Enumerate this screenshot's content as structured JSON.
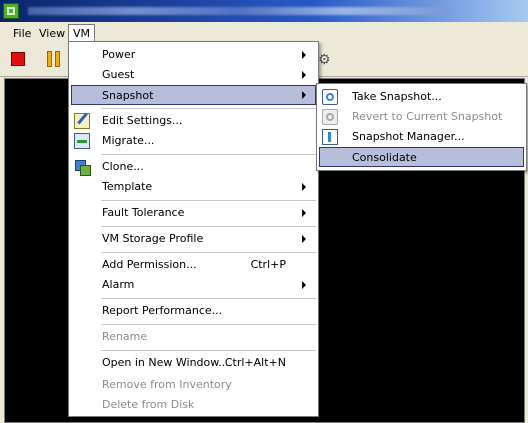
{
  "menubar": {
    "items": [
      {
        "label": "File"
      },
      {
        "label": "View"
      },
      {
        "label": "VM"
      }
    ]
  },
  "vm_menu": {
    "items": [
      {
        "label": "Power",
        "submenu": true
      },
      {
        "label": "Guest",
        "submenu": true
      },
      {
        "label": "Snapshot",
        "submenu": true,
        "highlighted": true
      },
      {
        "label": "Edit Settings...",
        "icon": "edit-settings-icon"
      },
      {
        "label": "Migrate...",
        "icon": "migrate-icon"
      },
      {
        "label": "Clone...",
        "icon": "clone-icon"
      },
      {
        "label": "Template",
        "submenu": true
      },
      {
        "label": "Fault Tolerance",
        "submenu": true
      },
      {
        "label": "VM Storage Profile",
        "submenu": true
      },
      {
        "label": "Add Permission...",
        "shortcut": "Ctrl+P"
      },
      {
        "label": "Alarm",
        "submenu": true
      },
      {
        "label": "Report Performance..."
      },
      {
        "label": "Rename",
        "disabled": true
      },
      {
        "label": "Open in New Window...",
        "shortcut": "Ctrl+Alt+N"
      },
      {
        "label": "Remove from Inventory",
        "disabled": true
      },
      {
        "label": "Delete from Disk",
        "disabled": true
      }
    ]
  },
  "snapshot_menu": {
    "items": [
      {
        "label": "Take Snapshot...",
        "icon": "take-snapshot-icon"
      },
      {
        "label": "Revert to Current Snapshot",
        "icon": "revert-snapshot-icon",
        "disabled": true
      },
      {
        "label": "Snapshot Manager...",
        "icon": "snapshot-manager-icon"
      },
      {
        "label": "Consolidate",
        "highlighted": true
      }
    ]
  },
  "colors": {
    "menu_highlight": "#b7bddb",
    "menu_highlight_border": "#31376f",
    "disabled_text": "#8c8c8c",
    "console_background": "#000000",
    "stop_button": "#e01010",
    "pause_button": "#f3b000"
  }
}
